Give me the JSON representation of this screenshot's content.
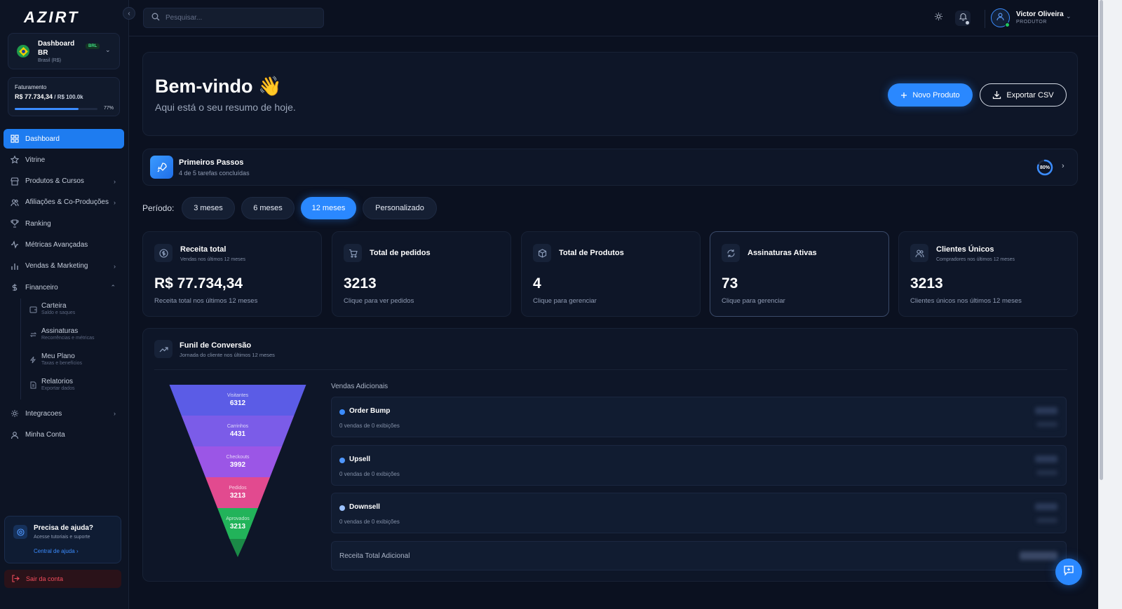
{
  "app": {
    "logo": "AZIRT"
  },
  "sidebar": {
    "dashboard_selector": {
      "title": "Dashboard BR",
      "subtitle": "Brasil (R$)",
      "badge": "BRL"
    },
    "billing": {
      "label": "Faturamento",
      "value": "R$ 77.734,34",
      "goal": " / R$ 100.0k",
      "percent_label": "77%",
      "progress": 0.77
    },
    "nav": [
      {
        "label": "Dashboard",
        "icon": "grid-icon"
      },
      {
        "label": "Vitrine",
        "icon": "star-icon"
      },
      {
        "label": "Produtos & Cursos",
        "icon": "store-icon"
      },
      {
        "label": "Afiliações & Co-Produções",
        "icon": "users-icon"
      },
      {
        "label": "Ranking",
        "icon": "trophy-icon"
      },
      {
        "label": "Métricas Avançadas",
        "icon": "activity-icon"
      },
      {
        "label": "Vendas & Marketing",
        "icon": "bar-chart-icon"
      },
      {
        "label": "Financeiro",
        "icon": "dollar-icon"
      }
    ],
    "financeiro_sub": [
      {
        "label": "Carteira",
        "sub": "Saldo e saques",
        "icon": "wallet-icon"
      },
      {
        "label": "Assinaturas",
        "sub": "Recorrências e métricas",
        "icon": "repeat-icon"
      },
      {
        "label": "Meu Plano",
        "sub": "Taxas e benefícios",
        "icon": "lightning-icon"
      },
      {
        "label": "Relatorios",
        "sub": "Exportar dados",
        "icon": "file-icon"
      }
    ],
    "nav_bottom": [
      {
        "label": "Integracoes",
        "icon": "settings-icon"
      },
      {
        "label": "Minha Conta",
        "icon": "user-icon"
      }
    ],
    "help": {
      "title": "Precisa de ajuda?",
      "subtitle": "Acesse tutoriais e suporte",
      "link": "Central de ajuda"
    },
    "logout": "Sair da conta"
  },
  "topbar": {
    "search_placeholder": "Pesquisar...",
    "user": {
      "name": "Victor Oliveira",
      "role": "PRODUTOR"
    }
  },
  "welcome": {
    "title": "Bem-vindo 👋",
    "subtitle": "Aqui está o seu resumo de hoje.",
    "new_product": "Novo Produto",
    "export_csv": "Exportar CSV"
  },
  "first_steps": {
    "title": "Primeiros Passos",
    "subtitle": "4 de 5 tarefas concluídas",
    "percent_label": "80%",
    "progress": 0.8
  },
  "period": {
    "label": "Período:",
    "options": [
      "3 meses",
      "6 meses",
      "12 meses",
      "Personalizado"
    ],
    "selected": "12 meses"
  },
  "kpis": [
    {
      "title": "Receita total",
      "subtitle": "Vendas nos últimos 12 meses",
      "value": "R$ 77.734,34",
      "footer": "Receita total nos últimos 12 meses",
      "icon": "dollar-circle-icon"
    },
    {
      "title": "Total de pedidos",
      "subtitle": "",
      "value": "3213",
      "footer": "Clique para ver pedidos",
      "icon": "cart-icon"
    },
    {
      "title": "Total de Produtos",
      "subtitle": "",
      "value": "4",
      "footer": "Clique para gerenciar",
      "icon": "box-icon"
    },
    {
      "title": "Assinaturas Ativas",
      "subtitle": "",
      "value": "73",
      "footer": "Clique para gerenciar",
      "icon": "refresh-icon"
    },
    {
      "title": "Clientes Únicos",
      "subtitle": "Compradores nos últimos 12 meses",
      "value": "3213",
      "footer": "Clientes únicos nos últimos 12 meses",
      "icon": "users-icon"
    }
  ],
  "funnel": {
    "title": "Funil de Conversão",
    "subtitle": "Jornada do cliente nos últimos 12 meses",
    "stages": [
      {
        "label": "Visitantes",
        "value": "6312",
        "color": "#5b5ce6"
      },
      {
        "label": "Carrinhos",
        "value": "4431",
        "color": "#7b5ce8"
      },
      {
        "label": "Checkouts",
        "value": "3992",
        "color": "#9b56e6"
      },
      {
        "label": "Pedidos",
        "value": "3213",
        "color": "#e24a8f"
      },
      {
        "label": "Aprovados",
        "value": "3213",
        "color": "#22b35a"
      }
    ],
    "additional_label": "Vendas Adicionais",
    "additional": [
      {
        "name": "Order Bump",
        "sub": "0 vendas de 0 exibições",
        "color": "#3b8cff"
      },
      {
        "name": "Upsell",
        "sub": "0 vendas de 0 exibições",
        "color": "#4f97ff"
      },
      {
        "name": "Downsell",
        "sub": "0 vendas de 0 exibições",
        "color": "#9bc2ff"
      }
    ],
    "total_label": "Receita Total Adicional"
  }
}
